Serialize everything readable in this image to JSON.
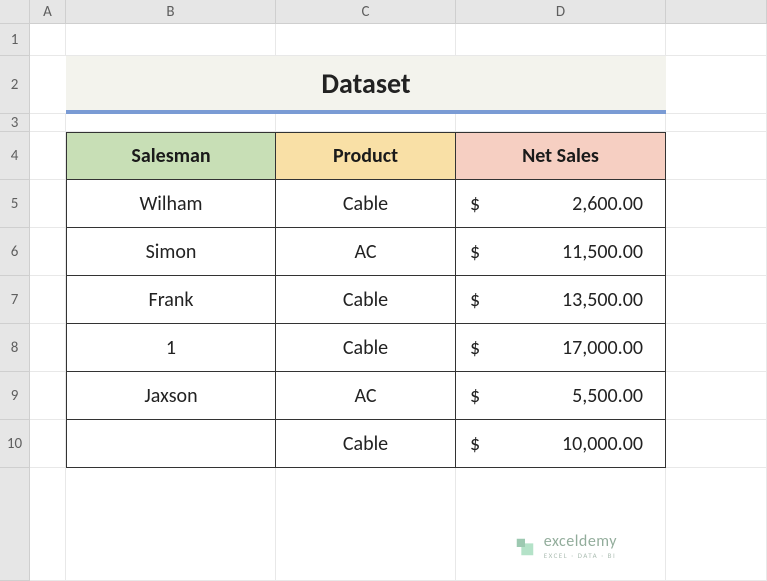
{
  "columns": [
    "A",
    "B",
    "C",
    "D"
  ],
  "rows": [
    "1",
    "2",
    "3",
    "4",
    "5",
    "6",
    "7",
    "8",
    "9",
    "10"
  ],
  "title": "Dataset",
  "headers": {
    "b": "Salesman",
    "c": "Product",
    "d": "Net Sales"
  },
  "data": [
    {
      "salesman": "Wilham",
      "product": "Cable",
      "currency": "$",
      "net_sales": "2,600.00"
    },
    {
      "salesman": "Simon",
      "product": "AC",
      "currency": "$",
      "net_sales": "11,500.00"
    },
    {
      "salesman": "Frank",
      "product": "Cable",
      "currency": "$",
      "net_sales": "13,500.00"
    },
    {
      "salesman": "1",
      "product": "Cable",
      "currency": "$",
      "net_sales": "17,000.00"
    },
    {
      "salesman": "Jaxson",
      "product": "AC",
      "currency": "$",
      "net_sales": "5,500.00"
    },
    {
      "salesman": "",
      "product": "Cable",
      "currency": "$",
      "net_sales": "10,000.00"
    }
  ],
  "watermark": {
    "main": "exceldemy",
    "sub": "EXCEL · DATA · BI"
  },
  "chart_data": {
    "type": "table",
    "title": "Dataset",
    "columns": [
      "Salesman",
      "Product",
      "Net Sales"
    ],
    "rows": [
      [
        "Wilham",
        "Cable",
        2600.0
      ],
      [
        "Simon",
        "AC",
        11500.0
      ],
      [
        "Frank",
        "Cable",
        13500.0
      ],
      [
        "1",
        "Cable",
        17000.0
      ],
      [
        "Jaxson",
        "AC",
        5500.0
      ],
      [
        "",
        "Cable",
        10000.0
      ]
    ],
    "currency": "$"
  }
}
